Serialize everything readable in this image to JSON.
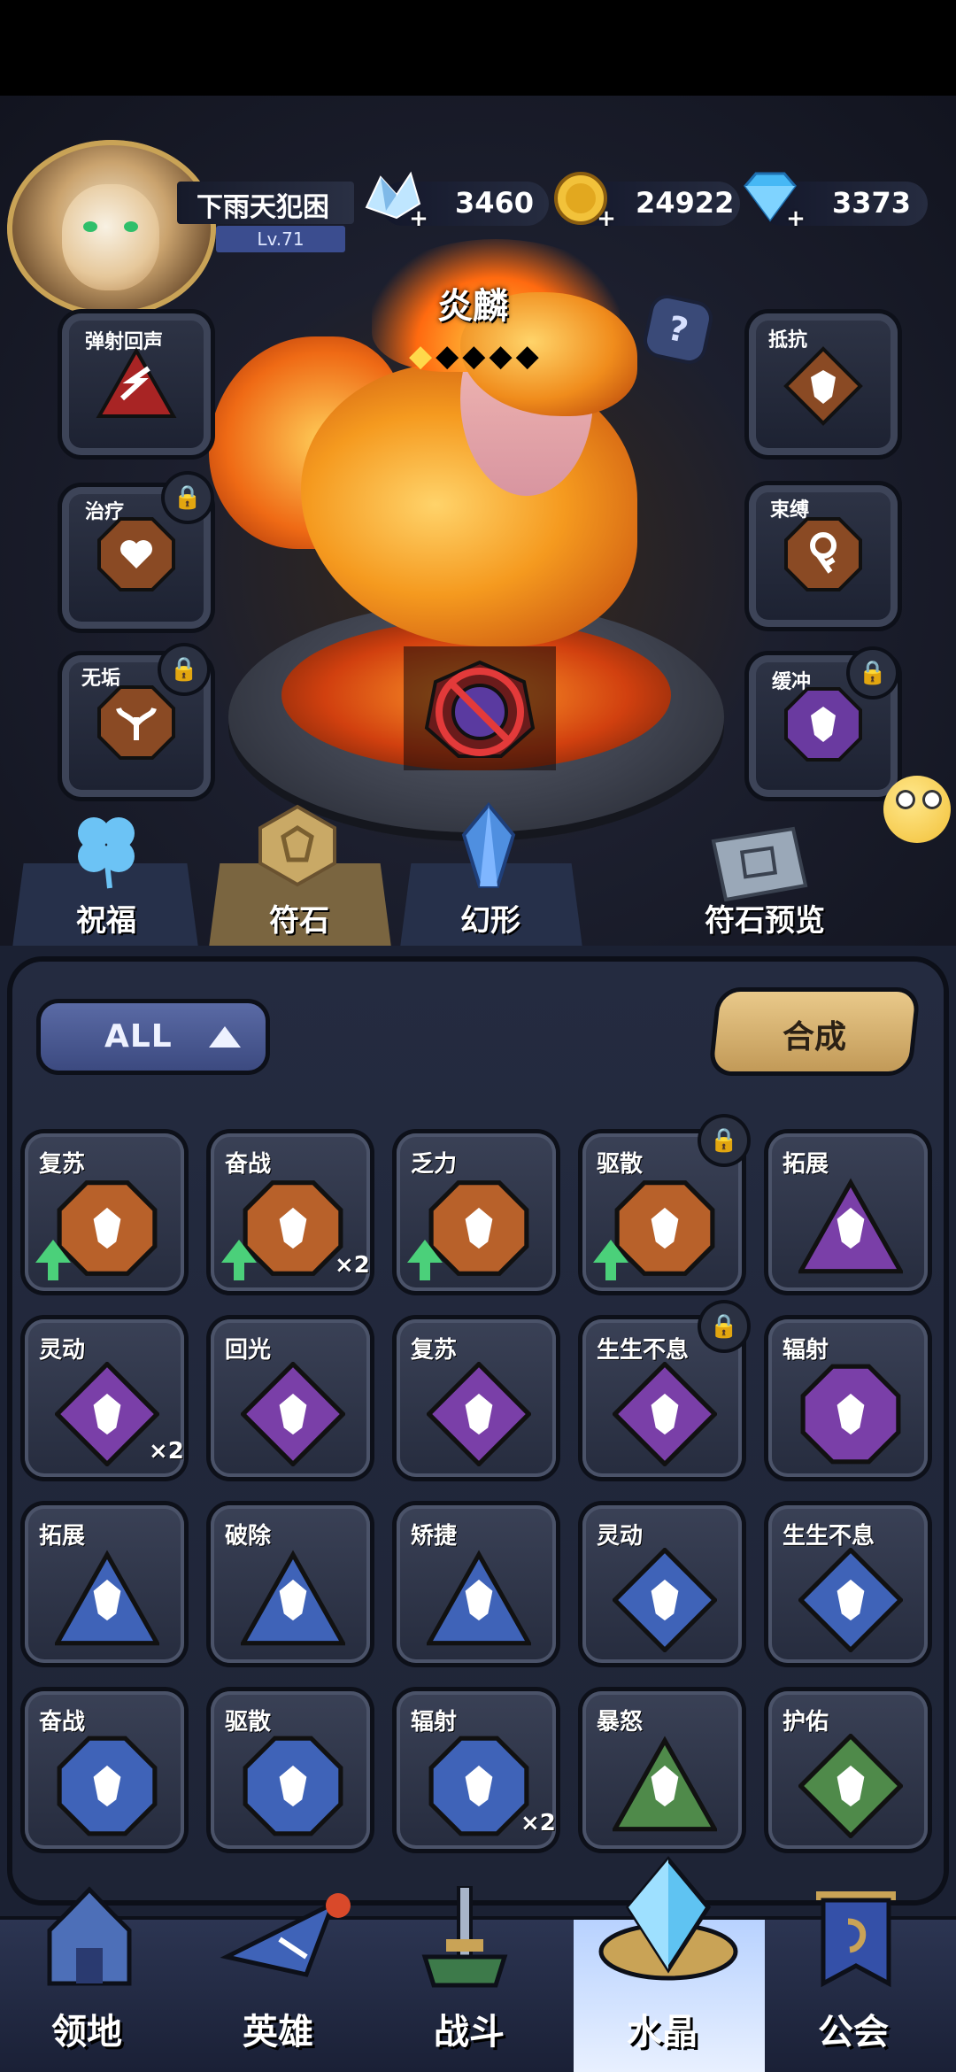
{
  "player": {
    "name": "下雨天犯困",
    "level": "Lv.71"
  },
  "resources": [
    {
      "icon": "crystal-cluster-icon",
      "value": "3460"
    },
    {
      "icon": "gold-coin-icon",
      "value": "24922"
    },
    {
      "icon": "diamond-icon",
      "value": "3373"
    }
  ],
  "hero": {
    "name": "炎麟",
    "stars": "◆◆◆◆◆"
  },
  "left_slots": [
    {
      "label": "弹射回声",
      "icon": "bounce-rune-icon",
      "locked": false
    },
    {
      "label": "治疗",
      "icon": "heal-rune-icon",
      "locked": true
    },
    {
      "label": "无垢",
      "icon": "pure-rune-icon",
      "locked": true
    }
  ],
  "right_slots": [
    {
      "label": "抵抗",
      "icon": "resist-rune-icon",
      "locked": false
    },
    {
      "label": "束缚",
      "icon": "bind-rune-icon",
      "locked": false
    },
    {
      "label": "缓冲",
      "icon": "buffer-rune-icon",
      "locked": true
    }
  ],
  "help": "?",
  "tabs": [
    {
      "label": "祝福",
      "icon": "clover-icon"
    },
    {
      "label": "符石",
      "icon": "rune-stone-icon"
    },
    {
      "label": "幻形",
      "icon": "blue-crystal-icon"
    },
    {
      "label": "符石预览",
      "icon": "rune-book-icon"
    }
  ],
  "filter": {
    "label": "ALL"
  },
  "craft": {
    "label": "合成"
  },
  "grid": [
    [
      {
        "label": "复苏",
        "shape": "hex",
        "color": "#b8612a",
        "count": "",
        "up": true,
        "locked": false
      },
      {
        "label": "奋战",
        "shape": "hex",
        "color": "#b8612a",
        "count": "×2",
        "up": true,
        "locked": false
      },
      {
        "label": "乏力",
        "shape": "hex",
        "color": "#b8612a",
        "count": "",
        "up": true,
        "locked": false
      },
      {
        "label": "驱散",
        "shape": "hex",
        "color": "#b8612a",
        "count": "",
        "up": true,
        "locked": true
      },
      {
        "label": "拓展",
        "shape": "tri",
        "color": "#7a3fa8",
        "count": "",
        "up": false,
        "locked": false
      }
    ],
    [
      {
        "label": "灵动",
        "shape": "diamond",
        "color": "#7a3fa8",
        "count": "×2",
        "up": false,
        "locked": false
      },
      {
        "label": "回光",
        "shape": "diamond",
        "color": "#7a3fa8",
        "count": "",
        "up": false,
        "locked": false
      },
      {
        "label": "复苏",
        "shape": "diamond",
        "color": "#7a3fa8",
        "count": "",
        "up": false,
        "locked": false
      },
      {
        "label": "生生不息",
        "shape": "diamond",
        "color": "#7a3fa8",
        "count": "",
        "up": false,
        "locked": true
      },
      {
        "label": "辐射",
        "shape": "oct",
        "color": "#7a3fa8",
        "count": "",
        "up": false,
        "locked": false
      }
    ],
    [
      {
        "label": "拓展",
        "shape": "tri",
        "color": "#3f63b8",
        "count": "",
        "up": false,
        "locked": false
      },
      {
        "label": "破除",
        "shape": "tri",
        "color": "#3f63b8",
        "count": "",
        "up": false,
        "locked": false
      },
      {
        "label": "矫捷",
        "shape": "tri",
        "color": "#3f63b8",
        "count": "",
        "up": false,
        "locked": false
      },
      {
        "label": "灵动",
        "shape": "diamond",
        "color": "#3f63b8",
        "count": "",
        "up": false,
        "locked": false
      },
      {
        "label": "生生不息",
        "shape": "diamond",
        "color": "#3f63b8",
        "count": "",
        "up": false,
        "locked": false
      }
    ],
    [
      {
        "label": "奋战",
        "shape": "oct",
        "color": "#3f63b8",
        "count": "",
        "up": false,
        "locked": false
      },
      {
        "label": "驱散",
        "shape": "oct",
        "color": "#3f63b8",
        "count": "",
        "up": false,
        "locked": false
      },
      {
        "label": "辐射",
        "shape": "oct",
        "color": "#3f63b8",
        "count": "×2",
        "up": false,
        "locked": false
      },
      {
        "label": "暴怒",
        "shape": "tri",
        "color": "#4f8a4a",
        "count": "",
        "up": false,
        "locked": false
      },
      {
        "label": "护佑",
        "shape": "diamond",
        "color": "#4f8a4a",
        "count": "",
        "up": false,
        "locked": false
      }
    ]
  ],
  "nav": [
    {
      "label": "领地",
      "icon": "castle-icon"
    },
    {
      "label": "英雄",
      "icon": "wizard-hat-icon"
    },
    {
      "label": "战斗",
      "icon": "sword-icon"
    },
    {
      "label": "水晶",
      "icon": "crystal-icon"
    },
    {
      "label": "公会",
      "icon": "banner-icon"
    }
  ]
}
